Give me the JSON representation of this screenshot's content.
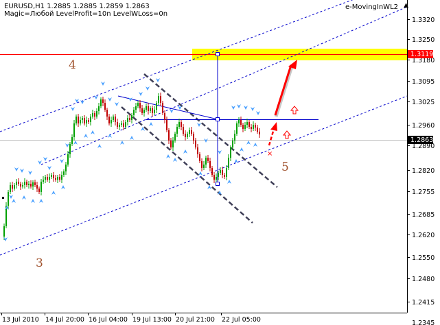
{
  "header": {
    "symbol_line": "EURUSD,H1  1.2885 1.2885 1.2859 1.2863",
    "params_line": "Magic=Любой  LevelProfit=10n  LevelWLoss=0n"
  },
  "indicator": {
    "name": "e-MovingInWL2",
    "arrow": "▲"
  },
  "price_axis": {
    "labels": [
      "1.3320",
      "1.3250",
      "1.3180",
      "1.3095",
      "1.3025",
      "1.2960",
      "1.2890",
      "1.2820",
      "1.2755",
      "1.2685",
      "1.2620",
      "1.2550",
      "1.2480",
      "1.2415",
      "1.2345"
    ],
    "current_price": "1.2863",
    "level_price": "1.3119",
    "level_color": "#ff0000",
    "current_color": "#000000"
  },
  "time_axis": {
    "labels": [
      "13 Jul 2010",
      "14 Jul 20:00",
      "16 Jul 04:00",
      "19 Jul 13:00",
      "20 Jul 21:00",
      "22 Jul 05:00"
    ]
  },
  "annotations": {
    "wave_3": "3",
    "wave_4": "4",
    "wave_5": "5",
    "label_color": "#a0522d"
  },
  "colors": {
    "up_candle": "#00a000",
    "down_candle": "#c00000",
    "channel_blue": "#0000cc",
    "channel_dark": "#404060",
    "target_zone": "#ffff00",
    "arrow_red": "#ff0000",
    "fractal": "#4aa0ff"
  }
}
